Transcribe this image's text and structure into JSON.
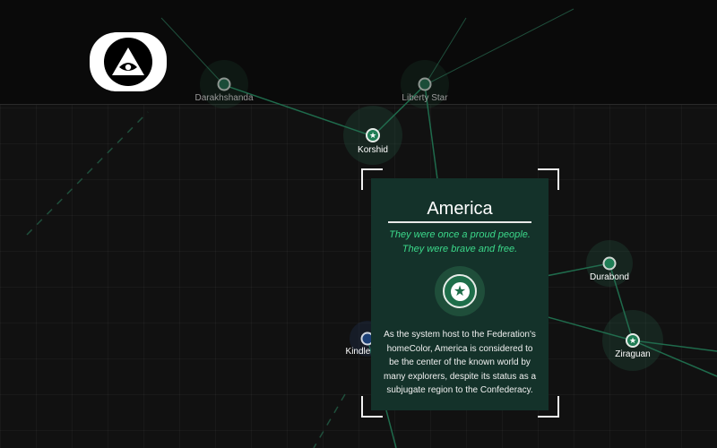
{
  "logo": {
    "icon": "all-seeing-eye-icon"
  },
  "colors": {
    "background": "#111111",
    "accent": "#1f7d55",
    "subtitle": "#3bd88a",
    "card": "#14322a"
  },
  "systems": [
    {
      "name": "Darakhshanda",
      "icon": "circle"
    },
    {
      "name": "Liberty Star",
      "icon": "circle"
    },
    {
      "name": "Korshid",
      "icon": "star"
    },
    {
      "name": "Durabond",
      "icon": "circle"
    },
    {
      "name": "Ziraguan",
      "icon": "star"
    },
    {
      "name": "Kindle Port",
      "icon": "circle"
    }
  ],
  "selected_system": {
    "name": "America",
    "tagline_line1": "They were once a proud people.",
    "tagline_line2": "They were brave and free.",
    "emblem": "star-icon",
    "description": "As the system host to the Federation's homeColor, America is considered to be the center of the known world by many explorers, despite its status as a subjugate region to the Confederacy."
  }
}
